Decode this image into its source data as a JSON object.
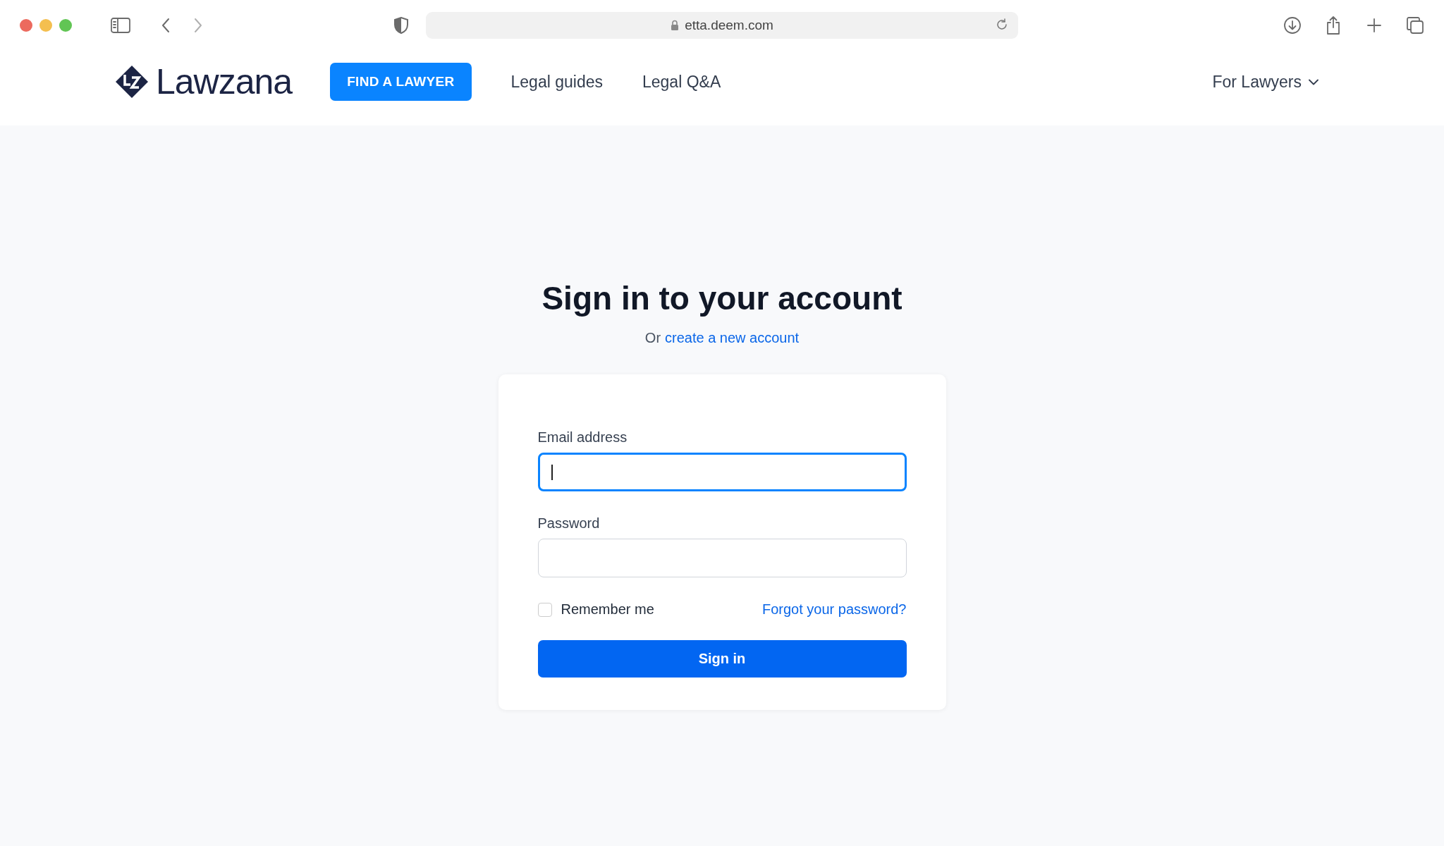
{
  "browser": {
    "url": "etta.deem.com"
  },
  "nav": {
    "logo": "Lawzana",
    "cta": "FIND A LAWYER",
    "links": [
      "Legal guides",
      "Legal Q&A"
    ],
    "menu": "For Lawyers"
  },
  "title": "Sign in to your account",
  "subtitle": {
    "prefix": "Or",
    "link": "create a new account"
  },
  "form": {
    "fields": [
      {
        "label": "Email address",
        "focused": true
      },
      {
        "label": "Password",
        "focused": false
      }
    ],
    "remember": {
      "label": "Remember me",
      "checked": false
    },
    "forgot": "Forgot your password?",
    "submit": "Sign in"
  }
}
